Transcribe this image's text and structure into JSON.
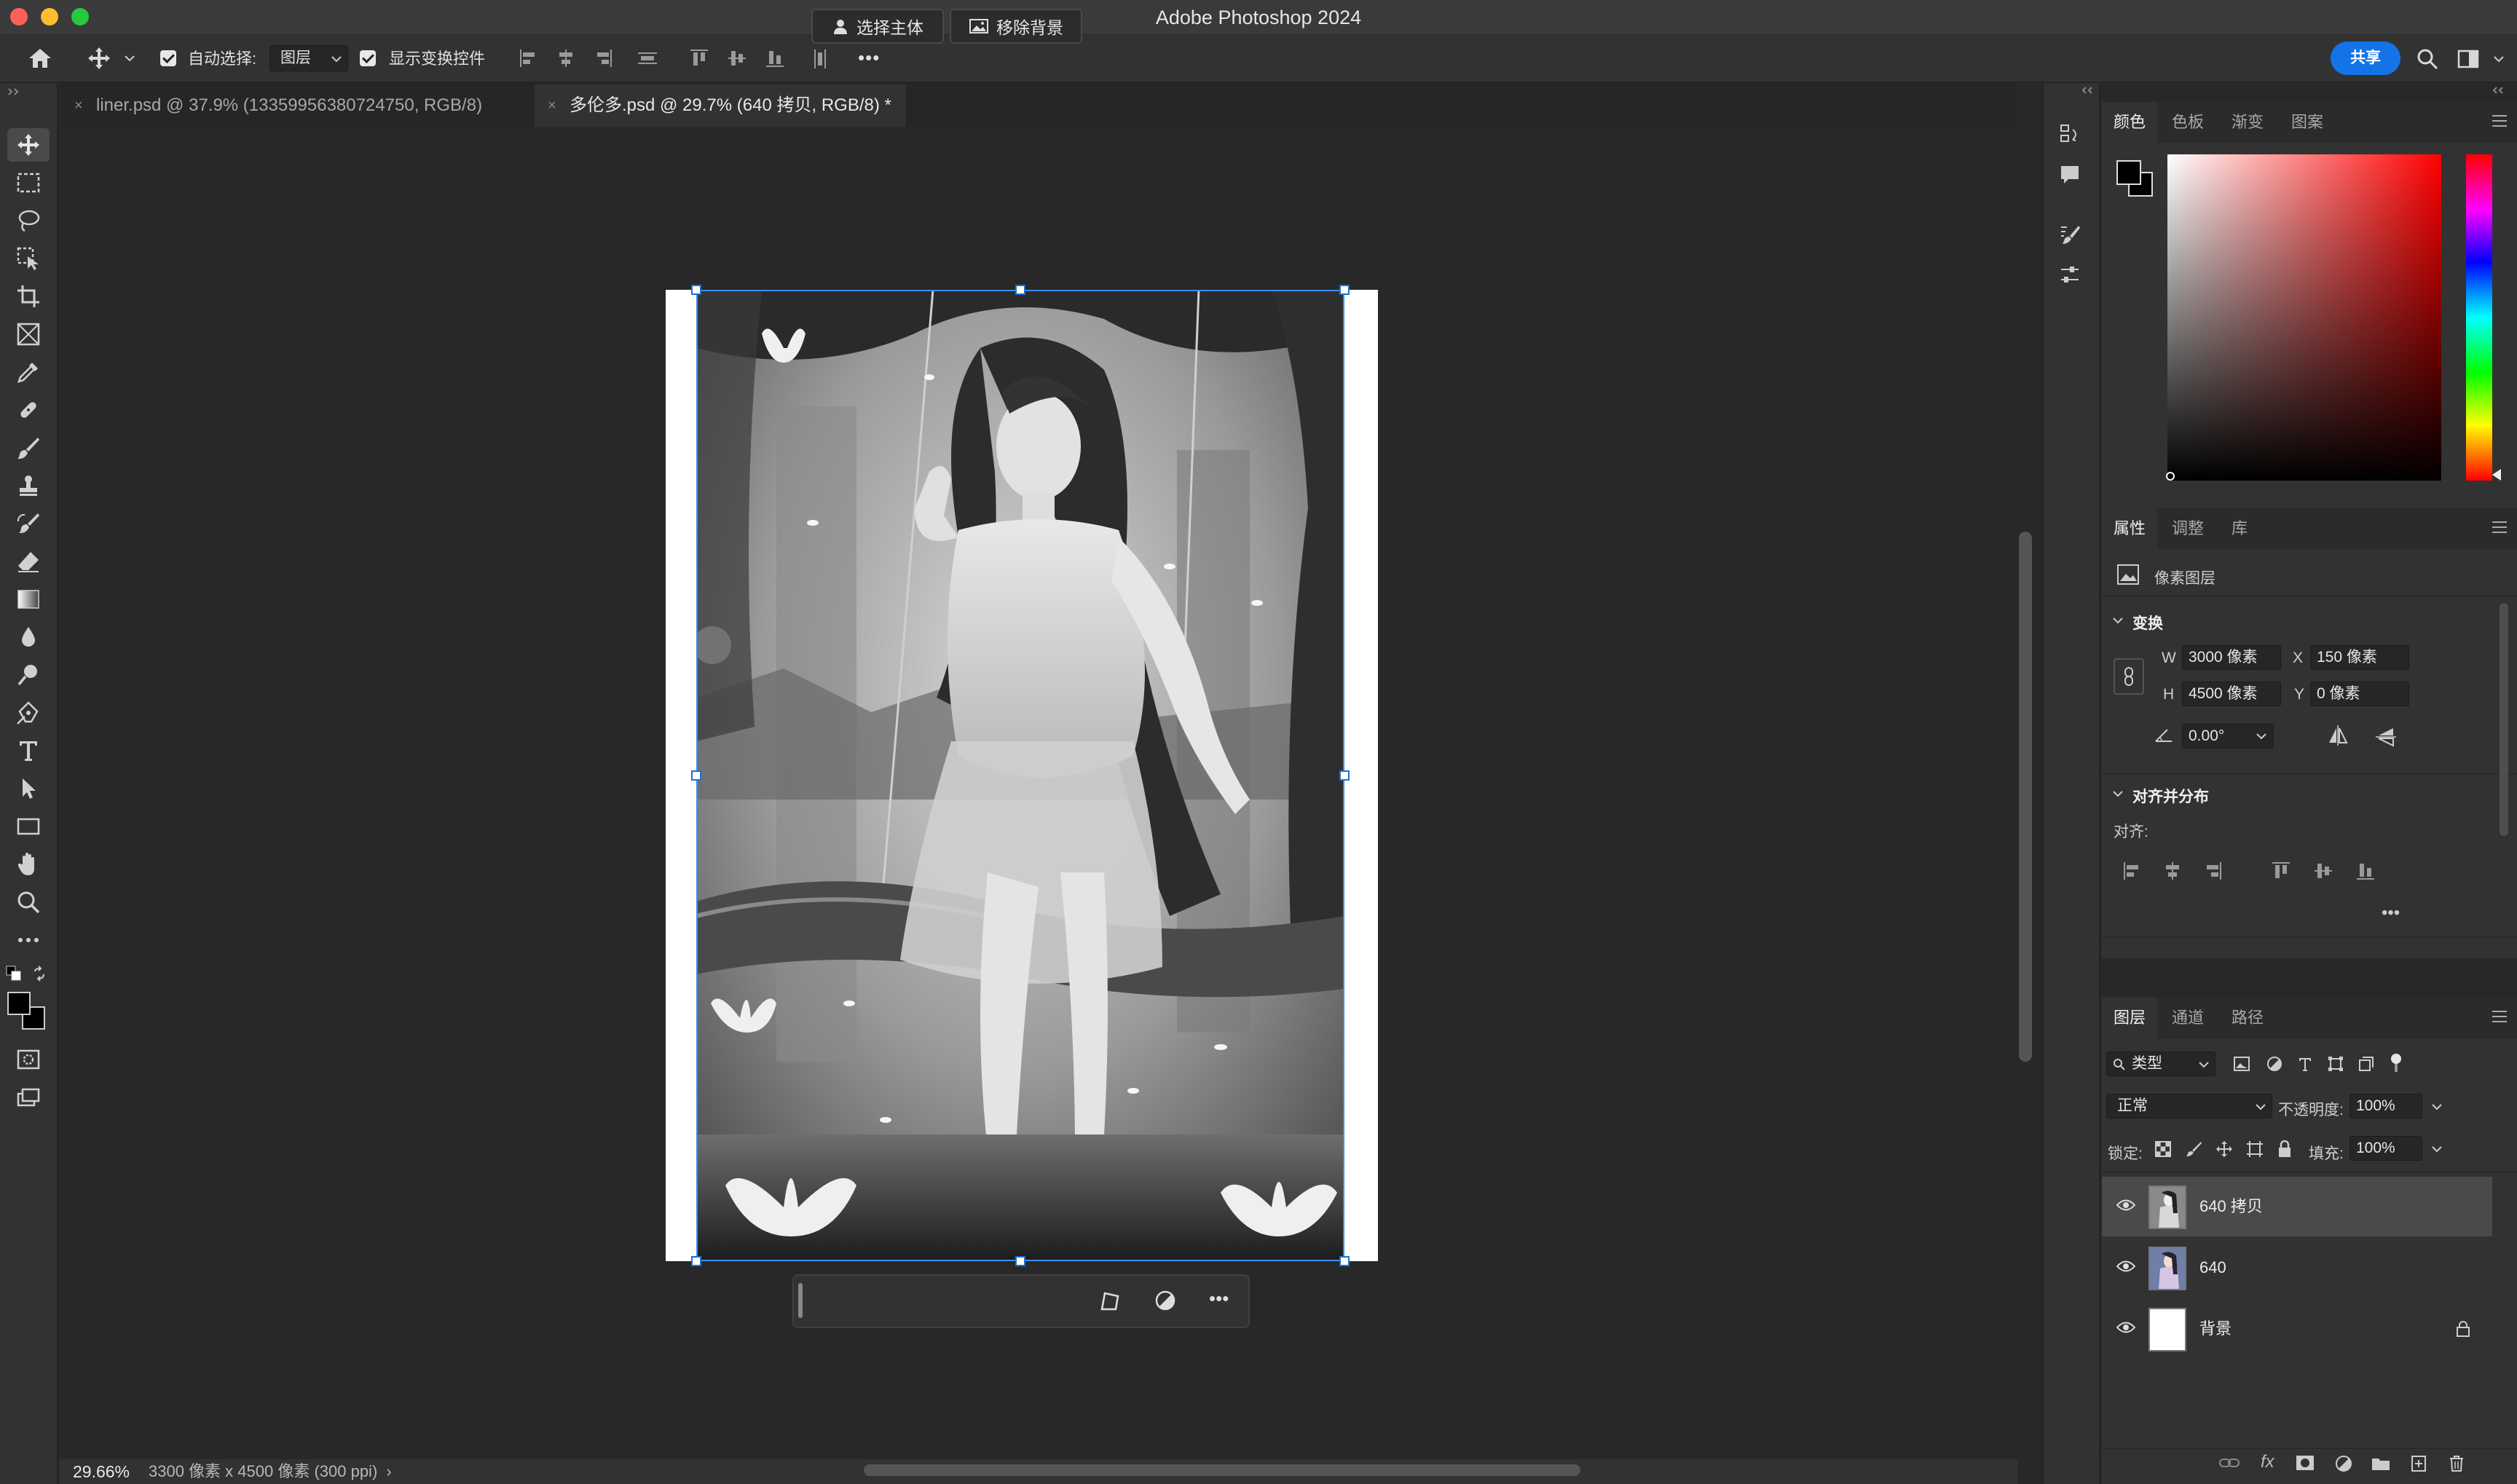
{
  "window": {
    "title": "Adobe Photoshop 2024"
  },
  "options_bar": {
    "auto_select_label": "自动选择:",
    "auto_select_value": "图层",
    "show_transform_label": "显示变换控件",
    "more_label": "•••",
    "share_label": "共享"
  },
  "tabs": [
    {
      "label": "liner.psd @ 37.9% (13359956380724750, RGB/8)",
      "active": false
    },
    {
      "label": "多伦多.psd @ 29.7% (640 拷贝, RGB/8) *",
      "active": true
    }
  ],
  "contextual_taskbar": {
    "select_subject": "选择主体",
    "remove_background": "移除背景",
    "more": "•••"
  },
  "status_bar": {
    "zoom": "29.66%",
    "doc_info": "3300 像素 x 4500 像素 (300 ppi)",
    "arrow": "›"
  },
  "color_panel": {
    "tabs": [
      "颜色",
      "色板",
      "渐变",
      "图案"
    ],
    "foreground": "#000000",
    "background": "#000000",
    "hue": "#ff0000"
  },
  "properties_panel": {
    "tabs": [
      "属性",
      "调整",
      "库"
    ],
    "layer_type": "像素图层",
    "transform_title": "变换",
    "w_label": "W",
    "w_value": "3000 像素",
    "x_label": "X",
    "x_value": "150 像素",
    "h_label": "H",
    "h_value": "4500 像素",
    "y_label": "Y",
    "y_value": "0 像素",
    "angle_value": "0.00°",
    "align_title": "对齐并分布",
    "align_label": "对齐:",
    "more": "•••"
  },
  "layers_panel": {
    "tabs": [
      "图层",
      "通道",
      "路径"
    ],
    "filter_label": "类型",
    "blend_mode": "正常",
    "opacity_label": "不透明度:",
    "opacity_value": "100%",
    "lock_label": "锁定:",
    "fill_label": "填充:",
    "fill_value": "100%",
    "layers": [
      {
        "name": "640 拷贝",
        "selected": true,
        "locked": false
      },
      {
        "name": "640",
        "selected": false,
        "locked": false
      },
      {
        "name": "背景",
        "selected": false,
        "locked": true
      }
    ],
    "footer_fx": "fx"
  },
  "colors": {
    "accent": "#1473e6",
    "selection": "#3d8ee8"
  }
}
